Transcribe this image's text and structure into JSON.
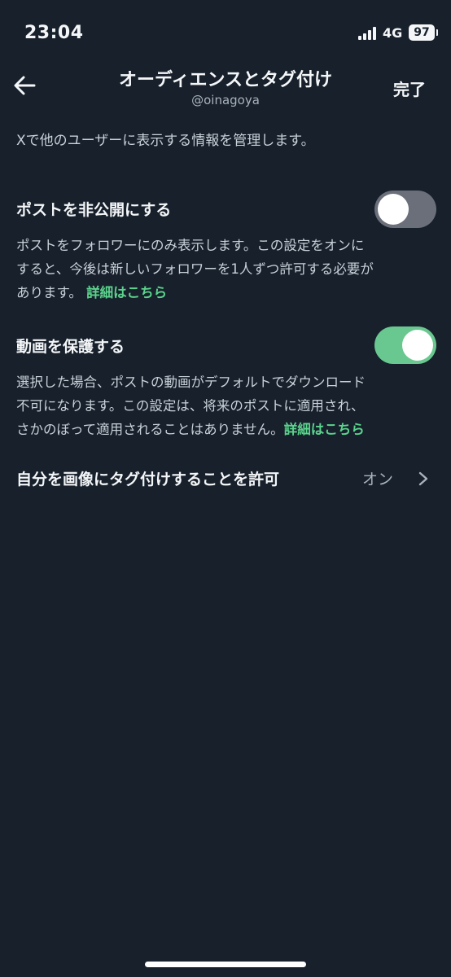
{
  "status": {
    "time": "23:04",
    "network": "4G",
    "battery": "97"
  },
  "header": {
    "title": "オーディエンスとタグ付け",
    "handle": "@oinagoya",
    "done_label": "完了"
  },
  "description": "Xで他のユーザーに表示する情報を管理します。",
  "protect_posts": {
    "title": "ポストを非公開にする",
    "enabled": false,
    "lines": [
      "ポストをフォロワーにのみ表示します。この設定をオンに",
      "すると、今後は新しいフォロワーを1人ずつ許可する必要が",
      "あります。"
    ],
    "link": "詳細はこちら"
  },
  "protect_videos": {
    "title": "動画を保護する",
    "enabled": true,
    "lines": [
      "選択した場合、ポストの動画がデフォルトでダウンロード",
      "不可になります。この設定は、将来のポストに適用され、",
      "さかのぼって適用されることはありません。"
    ],
    "link": "詳細はこちら"
  },
  "photo_tagging": {
    "label": "自分を画像にタグ付けすることを許可",
    "value": "オン"
  }
}
